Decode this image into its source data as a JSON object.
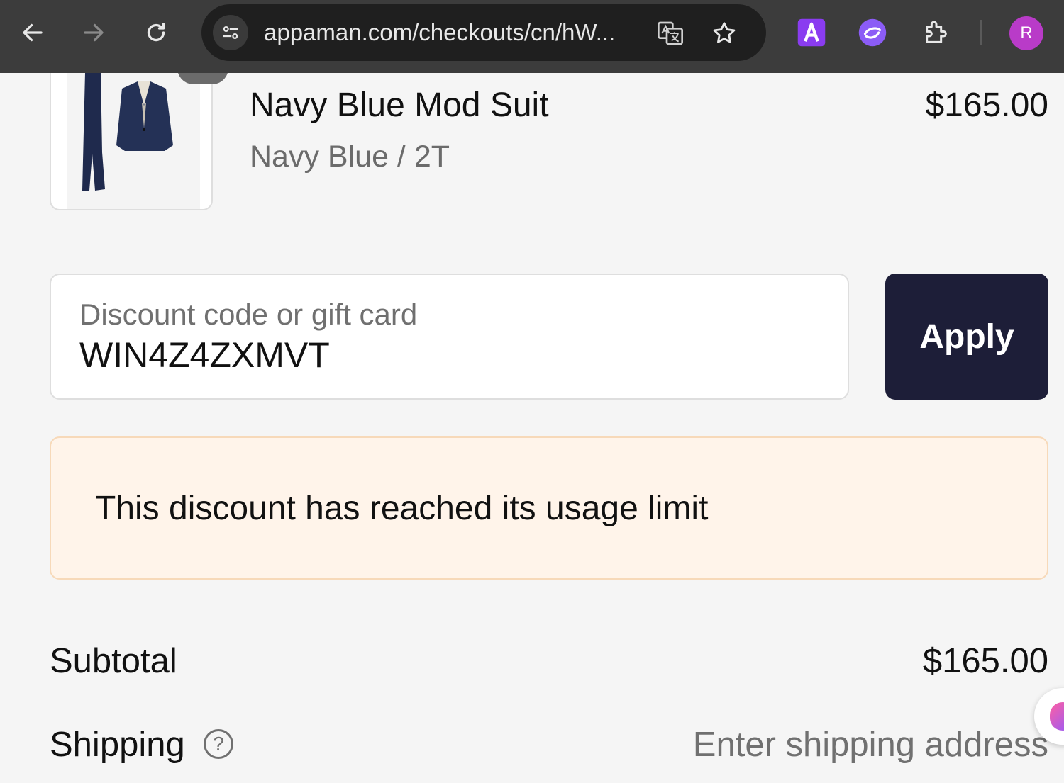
{
  "browser": {
    "url": "appaman.com/checkouts/cn/hW...",
    "profile_initial": "R",
    "icons": [
      "back-arrow-icon",
      "forward-arrow-icon",
      "reload-icon",
      "site-info-icon",
      "translate-icon",
      "bookmark-star-icon",
      "extension-a-icon",
      "extension-purple-icon",
      "extensions-puzzle-icon",
      "profile-avatar"
    ]
  },
  "order": {
    "item": {
      "name": "Navy Blue Mod Suit",
      "variant": "Navy Blue / 2T",
      "price": "$165.00"
    }
  },
  "discount": {
    "label": "Discount code or gift card",
    "value": "WIN4Z4ZXMVT",
    "apply_label": "Apply",
    "error": "This discount has reached its usage limit"
  },
  "summary": {
    "subtotal_label": "Subtotal",
    "subtotal_value": "$165.00",
    "shipping_label": "Shipping",
    "shipping_value": "Enter shipping address",
    "help_glyph": "?"
  },
  "colors": {
    "toolbar": "#3c3c3c",
    "apply_button": "#1d1e38",
    "alert_bg": "#fff4ea",
    "alert_border": "#f7d9b9",
    "avatar": "#b93bc8"
  }
}
